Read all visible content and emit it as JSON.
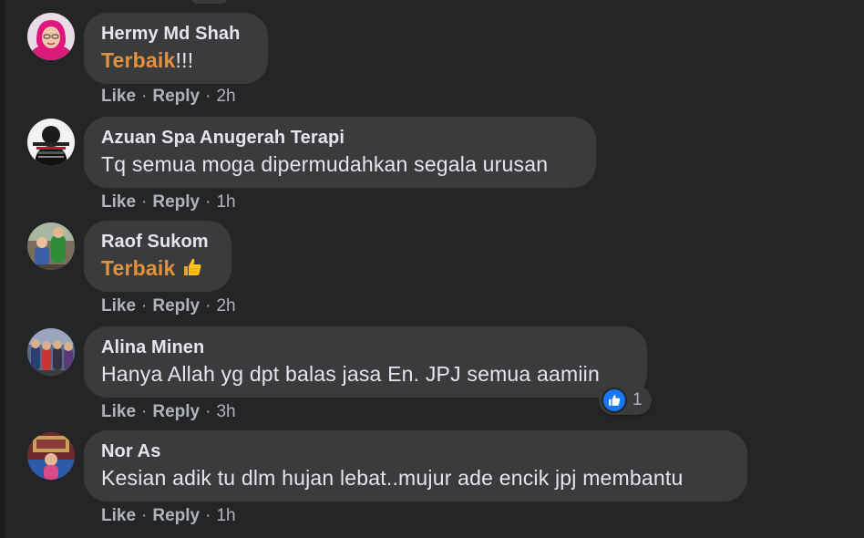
{
  "comments": [
    {
      "author": "Hermy Md Shah",
      "text_highlight": "Terbaik",
      "text_rest": "!!!",
      "like": "Like",
      "reply": "Reply",
      "time": "2h"
    },
    {
      "author": "Azuan Spa Anugerah Terapi",
      "text_rest": "Tq semua moga dipermudahkan segala urusan",
      "like": "Like",
      "reply": "Reply",
      "time": "1h"
    },
    {
      "author": "Raof Sukom",
      "text_highlight": "Terbaik",
      "emoji": "thumbs-up",
      "like": "Like",
      "reply": "Reply",
      "time": "2h"
    },
    {
      "author": "Alina Minen",
      "text_rest": "Hanya Allah yg dpt balas jasa En. JPJ semua aamiin",
      "like": "Like",
      "reply": "Reply",
      "time": "3h",
      "reaction": {
        "icon": "like-icon",
        "count": "1"
      }
    },
    {
      "author": "Nor As",
      "text_rest": "Kesian adik tu dlm hujan lebat..mujur ade encik jpj membantu",
      "like": "Like",
      "reply": "Reply",
      "time": "1h"
    }
  ],
  "colors": {
    "background": "#242526",
    "bubble": "#3a3b3c",
    "text": "#e4e6eb",
    "secondary_text": "#b0b3b8",
    "highlight": "#e4913b",
    "like_blue": "#1877f2"
  }
}
